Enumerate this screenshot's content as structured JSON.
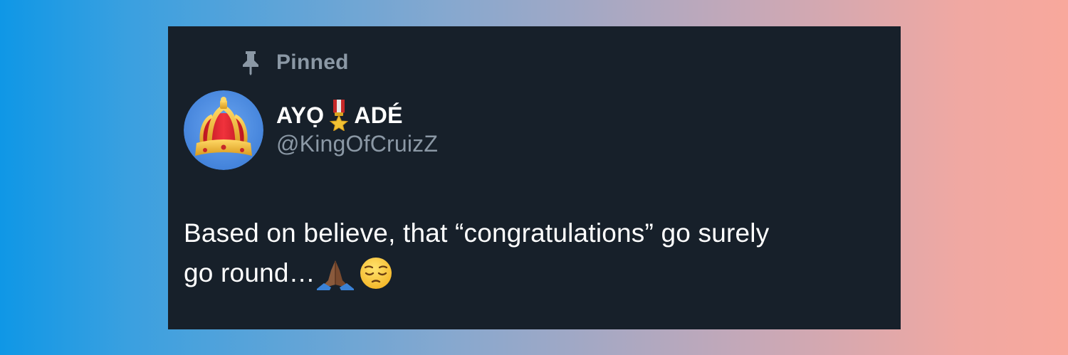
{
  "background": {
    "gradient_start": "#0f97e6",
    "gradient_end": "#f8a89c"
  },
  "card": {
    "background_color": "#17202a"
  },
  "pinned": {
    "icon": "pin-icon",
    "label": "Pinned"
  },
  "author": {
    "avatar": "crown-avatar",
    "name_part1": "AYỌ",
    "name_emoji": "military-medal-icon",
    "name_part2": "ADÉ",
    "handle": "@KingOfCruizZ"
  },
  "tweet": {
    "line1": "Based on believe, that “congratulations” go surely",
    "line2": "go round…",
    "emojis": [
      "folded-hands-icon",
      "pensive-face-icon"
    ]
  },
  "colors": {
    "primary_text": "#ffffff",
    "secondary_text": "#8b98a5",
    "avatar_bg": "#4d8fe0"
  }
}
